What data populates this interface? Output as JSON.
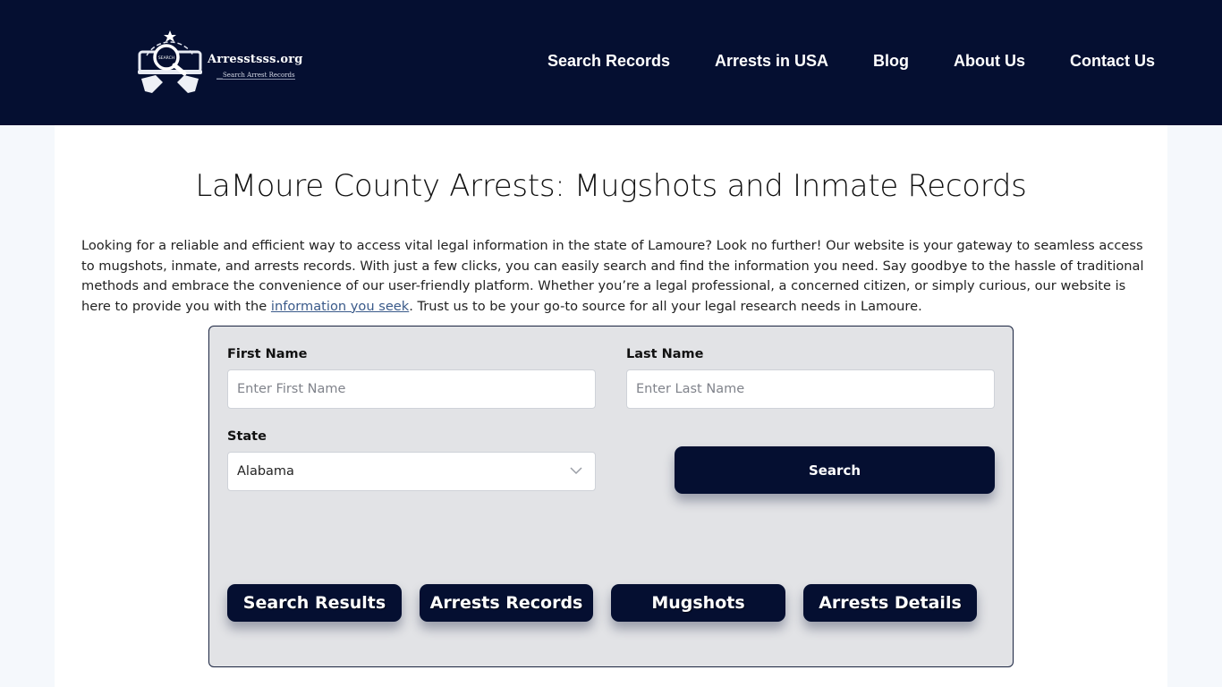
{
  "header": {
    "logo": {
      "title": "Arresstsss.org",
      "subtitle": "__Search Arrest Records",
      "badge_text": "SEARCH",
      "icon": "search-badge-logo-icon"
    },
    "nav": [
      {
        "label": "Search Records"
      },
      {
        "label": "Arrests in USA"
      },
      {
        "label": "Blog"
      },
      {
        "label": "About Us"
      },
      {
        "label": "Contact Us"
      }
    ]
  },
  "main": {
    "title": "LaMoure County Arrests: Mugshots and Inmate Records",
    "intro_before_link": "Looking for a reliable and efficient way to access vital legal information in the state of Lamoure? Look no further! Our website is your gateway to seamless access to mugshots, inmate, and arrests records. With just a few clicks, you can easily search and find the information you need. Say goodbye to the hassle of traditional methods and embrace the convenience of our user-friendly platform. Whether you’re a legal professional, a concerned citizen, or simply curious, our website is here to provide you with the ",
    "intro_link": "information you seek",
    "intro_after_link": ". Trust us to be your go-to source for all your legal research needs in Lamoure."
  },
  "form": {
    "first_name_label": "First Name",
    "first_name_placeholder": "Enter First Name",
    "first_name_value": "",
    "last_name_label": "Last Name",
    "last_name_placeholder": "Enter Last Name",
    "last_name_value": "",
    "state_label": "State",
    "state_selected": "Alabama",
    "search_label": "Search",
    "tabs": [
      {
        "label": "Search Results"
      },
      {
        "label": "Arrests Records"
      },
      {
        "label": "Mugshots"
      },
      {
        "label": "Arrests Details"
      }
    ]
  },
  "colors": {
    "header_bg": "#050f31",
    "button_bg": "#050f31",
    "form_bg": "#e2e3e6",
    "link": "#3a5a8a"
  }
}
